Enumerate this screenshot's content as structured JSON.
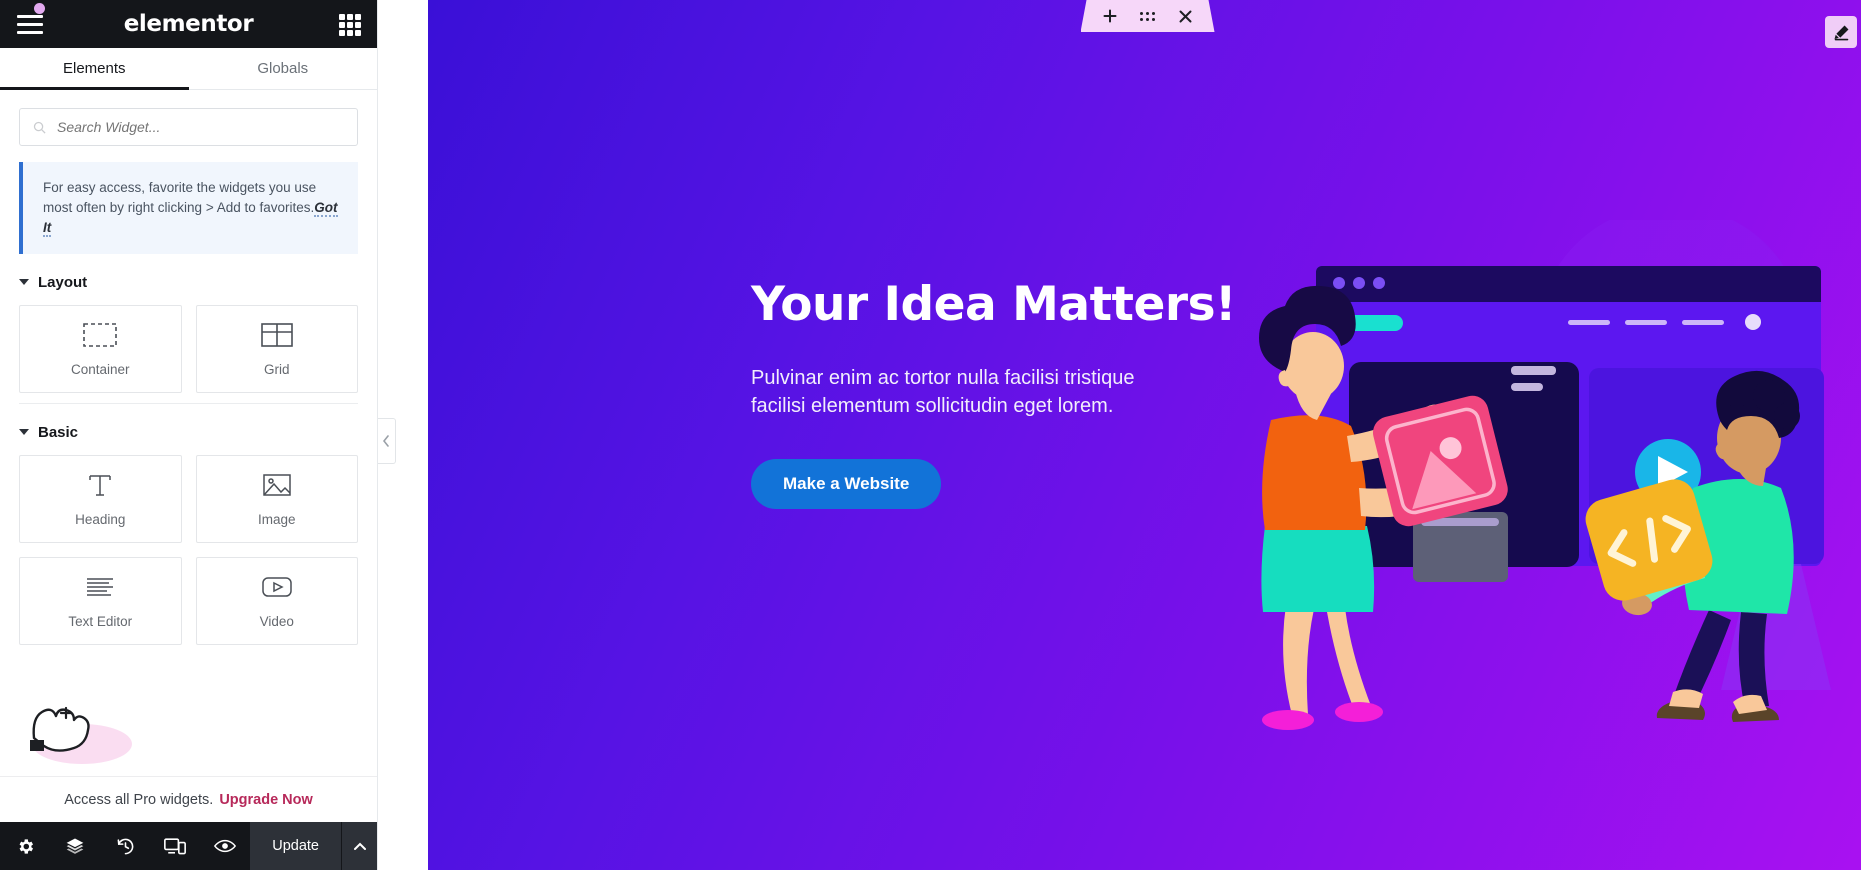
{
  "panel": {
    "header": {
      "brand": "elementor",
      "menu_icon": "hamburger-icon",
      "apps_icon": "apps-grid-icon"
    },
    "tabs": [
      {
        "label": "Elements",
        "active": true
      },
      {
        "label": "Globals",
        "active": false
      }
    ],
    "search": {
      "placeholder": "Search Widget...",
      "value": "",
      "icon": "search-icon"
    },
    "notice": {
      "text": "For easy access, favorite the widgets you use most often by right clicking > Add to favorites.",
      "action": "Got It",
      "accent": "#2f6fd0"
    },
    "sections": [
      {
        "title": "Layout",
        "widgets": [
          {
            "label": "Container",
            "icon": "container-icon"
          },
          {
            "label": "Grid",
            "icon": "grid-icon"
          }
        ]
      },
      {
        "title": "Basic",
        "widgets": [
          {
            "label": "Heading",
            "icon": "heading-icon"
          },
          {
            "label": "Image",
            "icon": "image-icon"
          },
          {
            "label": "Text Editor",
            "icon": "text-editor-icon"
          },
          {
            "label": "Video",
            "icon": "video-icon"
          }
        ]
      }
    ],
    "pro_bar": {
      "text": "Access all Pro widgets.",
      "link": "Upgrade Now",
      "link_color": "#b7295a"
    },
    "footer": {
      "icons": [
        {
          "name": "settings-gear-icon"
        },
        {
          "name": "navigator-layers-icon"
        },
        {
          "name": "history-icon"
        },
        {
          "name": "responsive-mode-icon"
        },
        {
          "name": "preview-eye-icon"
        }
      ],
      "update_label": "Update",
      "chevron": "chevron-up-icon"
    }
  },
  "canvas": {
    "section_toolbar": {
      "add": "+",
      "handle": "drag-handle-icon",
      "close": "×",
      "background": "#f6d7f9"
    },
    "edit_button": {
      "icon": "edit-pencil-icon",
      "background": "#f0cdf7"
    },
    "hero": {
      "heading": "Your Idea Matters!",
      "paragraph": "Pulvinar enim ac tortor nulla facilisi tristique facilisi elementum sollicitudin eget lorem.",
      "cta_label": "Make a Website",
      "cta_color": "#1273d8"
    },
    "background": {
      "from": "#3a10d7",
      "to": "#a911f1"
    },
    "illustration": {
      "name": "web-design-team-illustration",
      "colors": {
        "browser_bar": "#1c0a60",
        "browser_body": "#5c17f0",
        "pill": "#19e0d0",
        "card_pink": "#f0457e",
        "card_yellow": "#f5b423",
        "play_button": "#19b6e8",
        "shirt_orange": "#f2620f",
        "skirt_teal": "#16ddbf",
        "shoe_magenta": "#f41fd8",
        "shirt_mint": "#1fe6a8",
        "pants_navy": "#1b1057",
        "skin": "#f9c89a"
      }
    }
  },
  "cursor": {
    "name": "grab-hand-cursor"
  }
}
